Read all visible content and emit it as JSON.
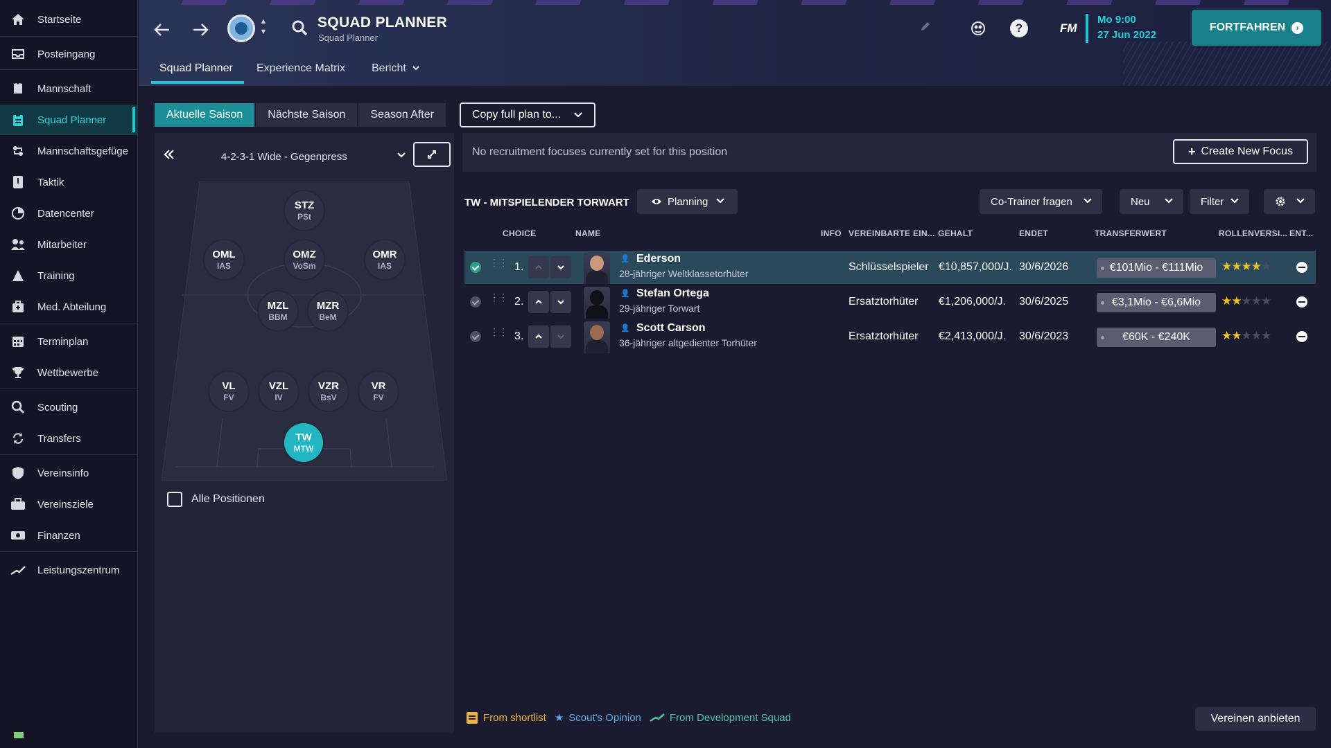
{
  "sidebar": {
    "items": [
      {
        "label": "Startseite",
        "icon": "home-icon"
      },
      {
        "label": "Posteingang",
        "icon": "inbox-icon"
      },
      {
        "label": "Mannschaft",
        "icon": "squad-icon"
      },
      {
        "label": "Squad Planner",
        "icon": "clipboard-icon",
        "active": true
      },
      {
        "label": "Mannschaftsgefüge",
        "icon": "dynamics-icon"
      },
      {
        "label": "Taktik",
        "icon": "tactics-icon"
      },
      {
        "label": "Datencenter",
        "icon": "data-icon"
      },
      {
        "label": "Mitarbeiter",
        "icon": "staff-icon"
      },
      {
        "label": "Training",
        "icon": "training-icon"
      },
      {
        "label": "Med. Abteilung",
        "icon": "medical-icon"
      },
      {
        "label": "Terminplan",
        "icon": "calendar-icon"
      },
      {
        "label": "Wettbewerbe",
        "icon": "trophy-icon"
      },
      {
        "label": "Scouting",
        "icon": "search-icon"
      },
      {
        "label": "Transfers",
        "icon": "transfer-icon"
      },
      {
        "label": "Vereinsinfo",
        "icon": "shield-icon"
      },
      {
        "label": "Vereinsziele",
        "icon": "briefcase-icon"
      },
      {
        "label": "Finanzen",
        "icon": "money-icon"
      },
      {
        "label": "Leistungszentrum",
        "icon": "development-icon"
      }
    ]
  },
  "header": {
    "title": "SQUAD PLANNER",
    "subtitle": "Squad Planner",
    "fm_logo": "FM",
    "date_time": "Mo 9:00",
    "date_day": "27 Jun 2022",
    "continue_label": "FORTFAHREN",
    "tabs": [
      "Squad Planner",
      "Experience Matrix",
      "Bericht"
    ]
  },
  "season_tabs": [
    "Aktuelle Saison",
    "Nächste Saison",
    "Season After"
  ],
  "copy_plan_label": "Copy full plan to...",
  "formation": "4-2-3-1 Wide - Gegenpress",
  "positions": [
    {
      "code": "STZ",
      "role": "PSt"
    },
    {
      "code": "OML",
      "role": "IAS"
    },
    {
      "code": "OMZ",
      "role": "VoSm"
    },
    {
      "code": "OMR",
      "role": "IAS"
    },
    {
      "code": "MZL",
      "role": "BBM"
    },
    {
      "code": "MZR",
      "role": "BeM"
    },
    {
      "code": "VL",
      "role": "FV"
    },
    {
      "code": "VZL",
      "role": "IV"
    },
    {
      "code": "VZR",
      "role": "BsV"
    },
    {
      "code": "VR",
      "role": "FV"
    },
    {
      "code": "TW",
      "role": "MTW"
    }
  ],
  "all_positions_label": "Alle Positionen",
  "focus_text": "No recruitment focuses currently set for this position",
  "create_focus_label": "Create New Focus",
  "position_title": "TW - MITSPIELENDER TORWART",
  "planning_label": "Planning",
  "toolbar": {
    "ask_coach": "Co-Trainer fragen",
    "new": "Neu",
    "filter": "Filter"
  },
  "columns": {
    "choice": "CHOICE",
    "name": "NAME",
    "info": "INFO",
    "contract": "VEREINBARTE EIN...",
    "wage": "GEHALT",
    "ends": "ENDET",
    "value": "TRANSFERWERT",
    "role": "ROLLENVERSI...",
    "ent": "ENT..."
  },
  "players": [
    {
      "rank": "1.",
      "name": "Ederson",
      "desc": "28-jähriger Weltklassetorhüter",
      "contract": "Schlüsselspieler",
      "wage": "€10,857,000/J.",
      "ends": "30/6/2026",
      "value": "€101Mio - €111Mio",
      "stars": 4
    },
    {
      "rank": "2.",
      "name": "Stefan Ortega",
      "desc": "29-jähriger Torwart",
      "contract": "Ersatztorhüter",
      "wage": "€1,206,000/J.",
      "ends": "30/6/2025",
      "value": "€3,1Mio - €6,6Mio",
      "stars": 2
    },
    {
      "rank": "3.",
      "name": "Scott Carson",
      "desc": "36-jähriger altgedienter Torhüter",
      "contract": "Ersatztorhüter",
      "wage": "€2,413,000/J.",
      "ends": "30/6/2023",
      "value": "€60K - €240K",
      "stars": 2
    }
  ],
  "legend": {
    "shortlist": "From shortlist",
    "scout": "Scout's Opinion",
    "dev": "From Development Squad"
  },
  "offer_label": "Vereinen anbieten",
  "colors": {
    "accent": "#22c6d0",
    "continue": "#17808a",
    "star": "#f0c020"
  }
}
